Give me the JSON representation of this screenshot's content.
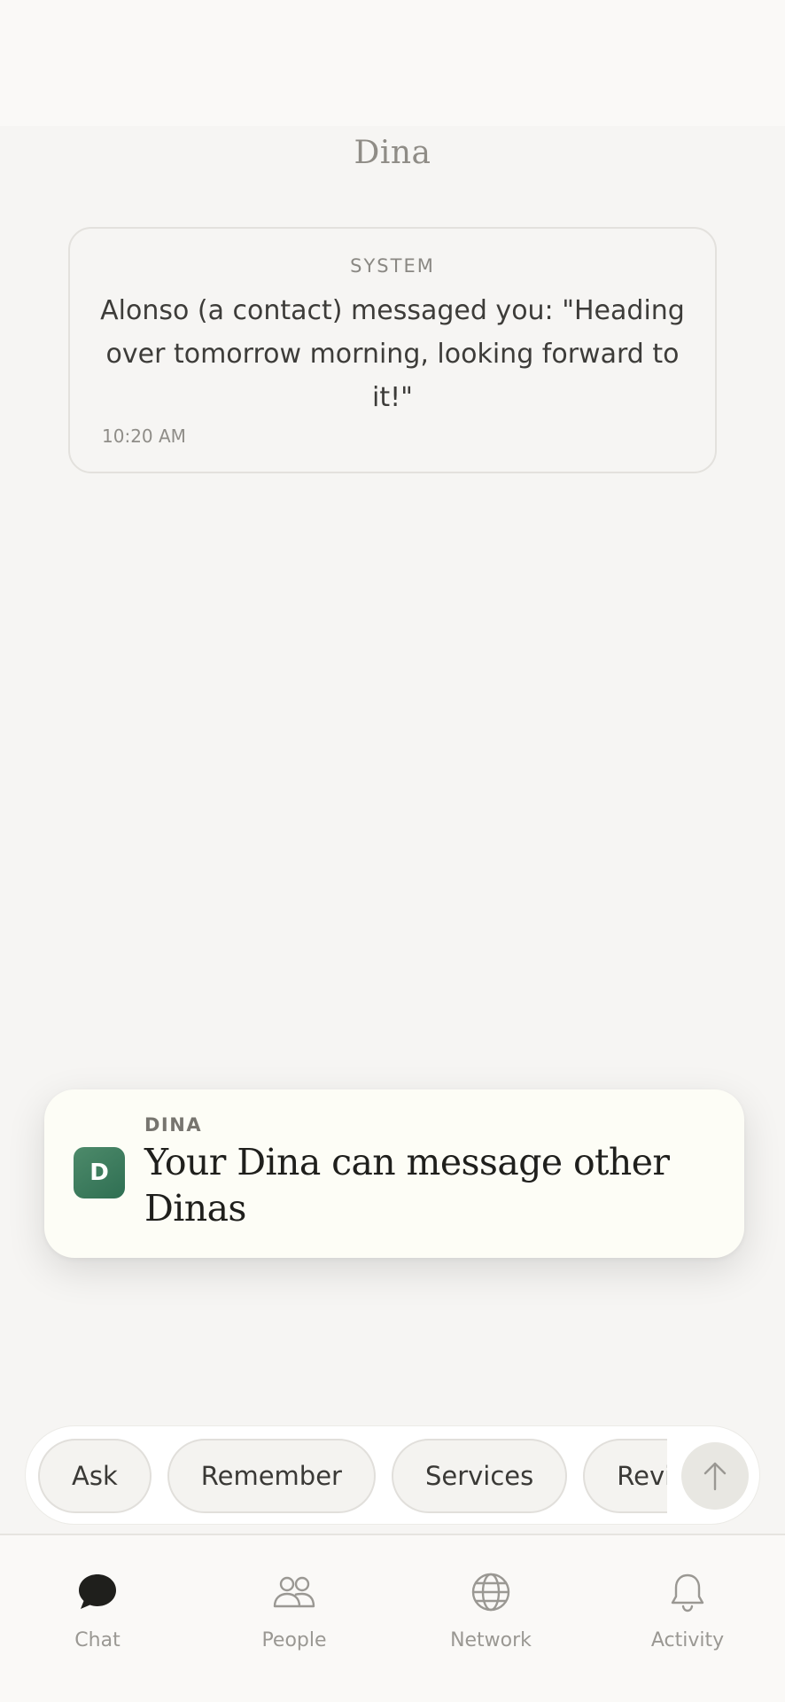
{
  "header": {
    "title": "Dina"
  },
  "system_card": {
    "label": "SYSTEM",
    "message": "Alonso (a contact) messaged you: \"Heading over tomorrow morning, looking forward to it!\"",
    "time": "10:20 AM"
  },
  "toast": {
    "avatar_letter": "D",
    "label": "DINA",
    "title": "Your Dina can message other Dinas",
    "avatar_color": "#3f7d5f"
  },
  "chips": [
    {
      "label": "Ask"
    },
    {
      "label": "Remember"
    },
    {
      "label": "Services"
    },
    {
      "label": "Review"
    }
  ],
  "send_icon": "arrow-up-icon",
  "tabs": [
    {
      "label": "Chat",
      "icon": "chat-bubble-icon",
      "active": true
    },
    {
      "label": "People",
      "icon": "people-icon",
      "active": false
    },
    {
      "label": "Network",
      "icon": "globe-icon",
      "active": false
    },
    {
      "label": "Activity",
      "icon": "bell-icon",
      "active": false
    }
  ],
  "colors": {
    "background": "#f6f5f3",
    "toast_background": "#fdfdf6",
    "active_icon": "#1f1f1c",
    "inactive_icon": "#9a9893"
  }
}
